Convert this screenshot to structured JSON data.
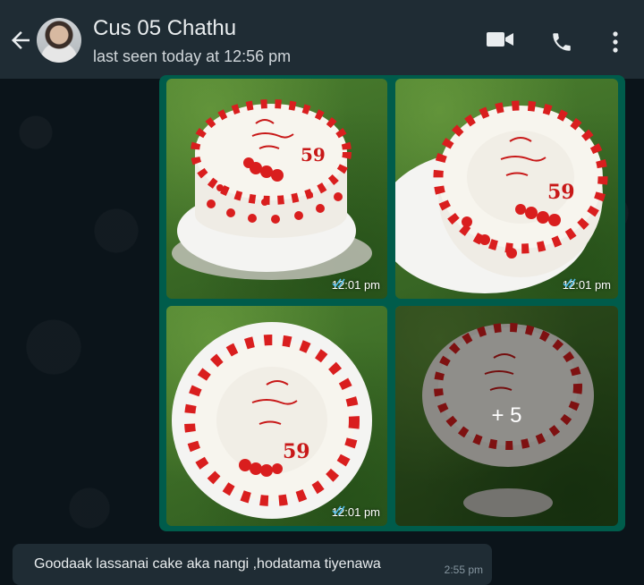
{
  "header": {
    "contact_name": "Cus 05 Chathu",
    "status": "last seen today at 12:56 pm",
    "background_color": "#1f2c34",
    "icons": [
      "back-arrow-icon",
      "video-call-icon",
      "phone-call-icon",
      "more-options-icon"
    ]
  },
  "album": {
    "bubble_color": "#005c4b",
    "photos": [
      {
        "time": "12:01 pm",
        "read": true
      },
      {
        "time": "12:01 pm",
        "read": true
      },
      {
        "time": "12:01 pm",
        "read": true
      },
      {
        "more_count": "+ 5"
      }
    ]
  },
  "message": {
    "text": "Goodaak lassanai cake aka nangi ,hodatama tiyenawa",
    "time": "2:55 pm",
    "bubble_color": "#1f2c34"
  },
  "colors": {
    "read_ticks": "#53bdeb",
    "wallpaper": "#0b141a"
  }
}
